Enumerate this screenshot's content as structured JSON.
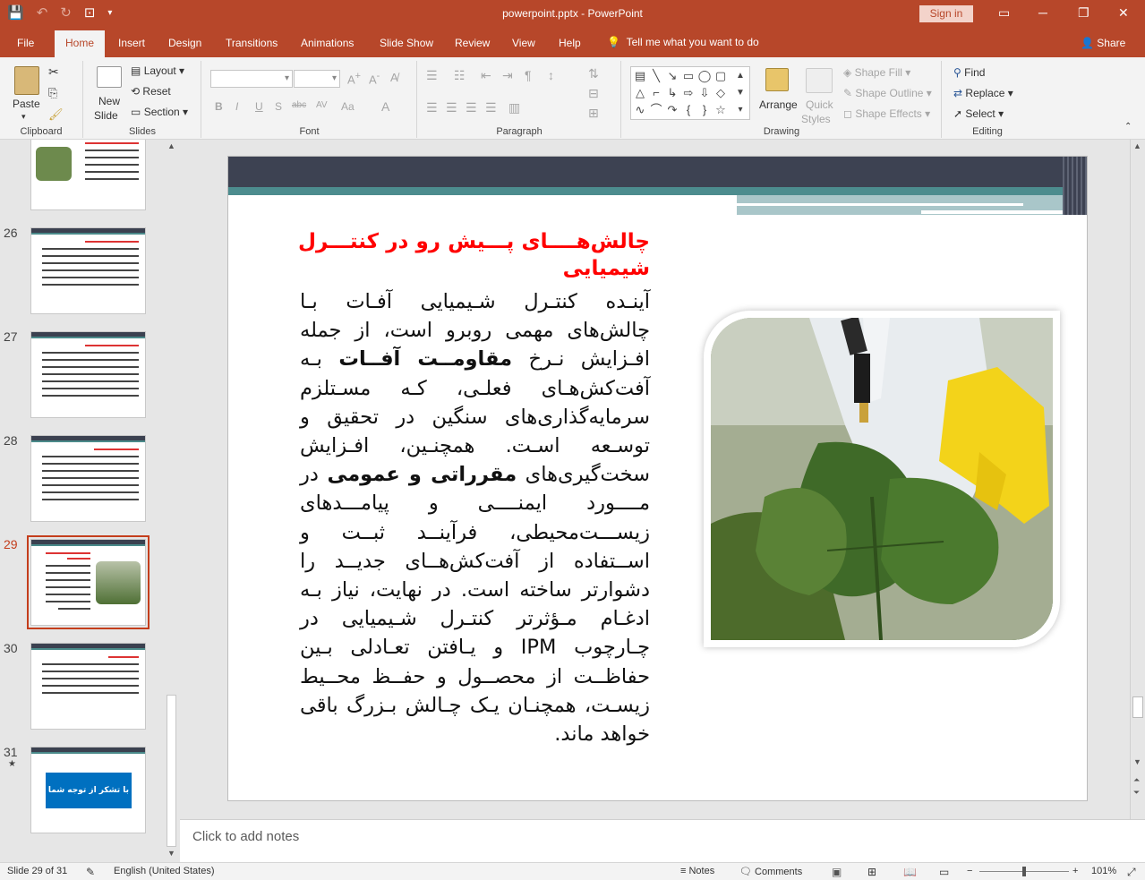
{
  "window": {
    "title": "powerpoint.pptx  -  PowerPoint",
    "signin_label": "Sign in"
  },
  "tabs": {
    "items": [
      {
        "label": "File"
      },
      {
        "label": "Home"
      },
      {
        "label": "Insert"
      },
      {
        "label": "Design"
      },
      {
        "label": "Transitions"
      },
      {
        "label": "Animations"
      },
      {
        "label": "Slide Show"
      },
      {
        "label": "Review"
      },
      {
        "label": "View"
      },
      {
        "label": "Help"
      }
    ],
    "active": "Home",
    "tell_me": "Tell me what you want to do",
    "share": "Share"
  },
  "ribbon": {
    "clipboard": {
      "label": "Clipboard",
      "paste": "Paste"
    },
    "slides": {
      "label": "Slides",
      "new_slide_1": "New",
      "new_slide_2": "Slide",
      "layout": "Layout",
      "reset": "Reset",
      "section": "Section"
    },
    "font": {
      "label": "Font",
      "bold": "B",
      "italic": "I",
      "underline": "U",
      "shadow": "S",
      "strike": "abc",
      "spacing": "AV",
      "case": "Aa",
      "color": "A"
    },
    "paragraph": {
      "label": "Paragraph"
    },
    "drawing": {
      "label": "Drawing",
      "arrange": "Arrange",
      "quick_styles_1": "Quick",
      "quick_styles_2": "Styles",
      "shape_fill": "Shape Fill",
      "shape_outline": "Shape Outline",
      "shape_effects": "Shape Effects"
    },
    "editing": {
      "label": "Editing",
      "find": "Find",
      "replace": "Replace",
      "select": "Select"
    }
  },
  "thumbnails": [
    {
      "number": "26"
    },
    {
      "number": "27"
    },
    {
      "number": "28"
    },
    {
      "number": "29",
      "selected": true
    },
    {
      "number": "30"
    },
    {
      "number": "31",
      "star": "★",
      "label": "با تشکر از توجه شما"
    }
  ],
  "slide": {
    "title": "چالش‌هــــای پـــیش رو در کنتـــرل شیمیایی",
    "body_parts": [
      "آینـده کنتـرل شـیمیایی آفـات بـا چالش‌های مهمی روبرو است، از جمله افـزایش نـرخ ",
      "مقاومــت آفــات",
      " بـه آفت‌کش‌هـای فعلـی، کـه مسـتلزم سرمایه‌گذاری‌های سنگین در تحقیق و توسـعه اسـت. همچنـین، افـزایش سخت‌گیری‌های ",
      "مقرراتی و عمومی",
      " در مــــورد ایمنــــی و پیامـــدهای زیســـت‌محیطی، فرآینــد ثبــت و اســتفاده از آفت‌کش‌هــای جدیــد را دشوارتر ساخته است. در نهایت، نیاز بـه ادغـام مـؤثرتر کنتـرل شـیمیایی در چـارچوب IPM و یـافتن تعـادلی بـین حفاظــت از محصــول و حفــظ محــیط زیسـت، همچنـان یـک چـالش بـزرگ باقی خواهد ماند."
    ]
  },
  "notes": {
    "placeholder": "Click to add notes"
  },
  "status": {
    "slide_counter": "Slide 29 of 31",
    "language": "English (United States)",
    "notes": "Notes",
    "comments": "Comments",
    "zoom": "101%"
  },
  "colors": {
    "accent": "#b7472a",
    "slide_title": "#ff0000",
    "slide_bar_dark": "#3d4252",
    "slide_bar_teal": "#4c8c8e"
  }
}
